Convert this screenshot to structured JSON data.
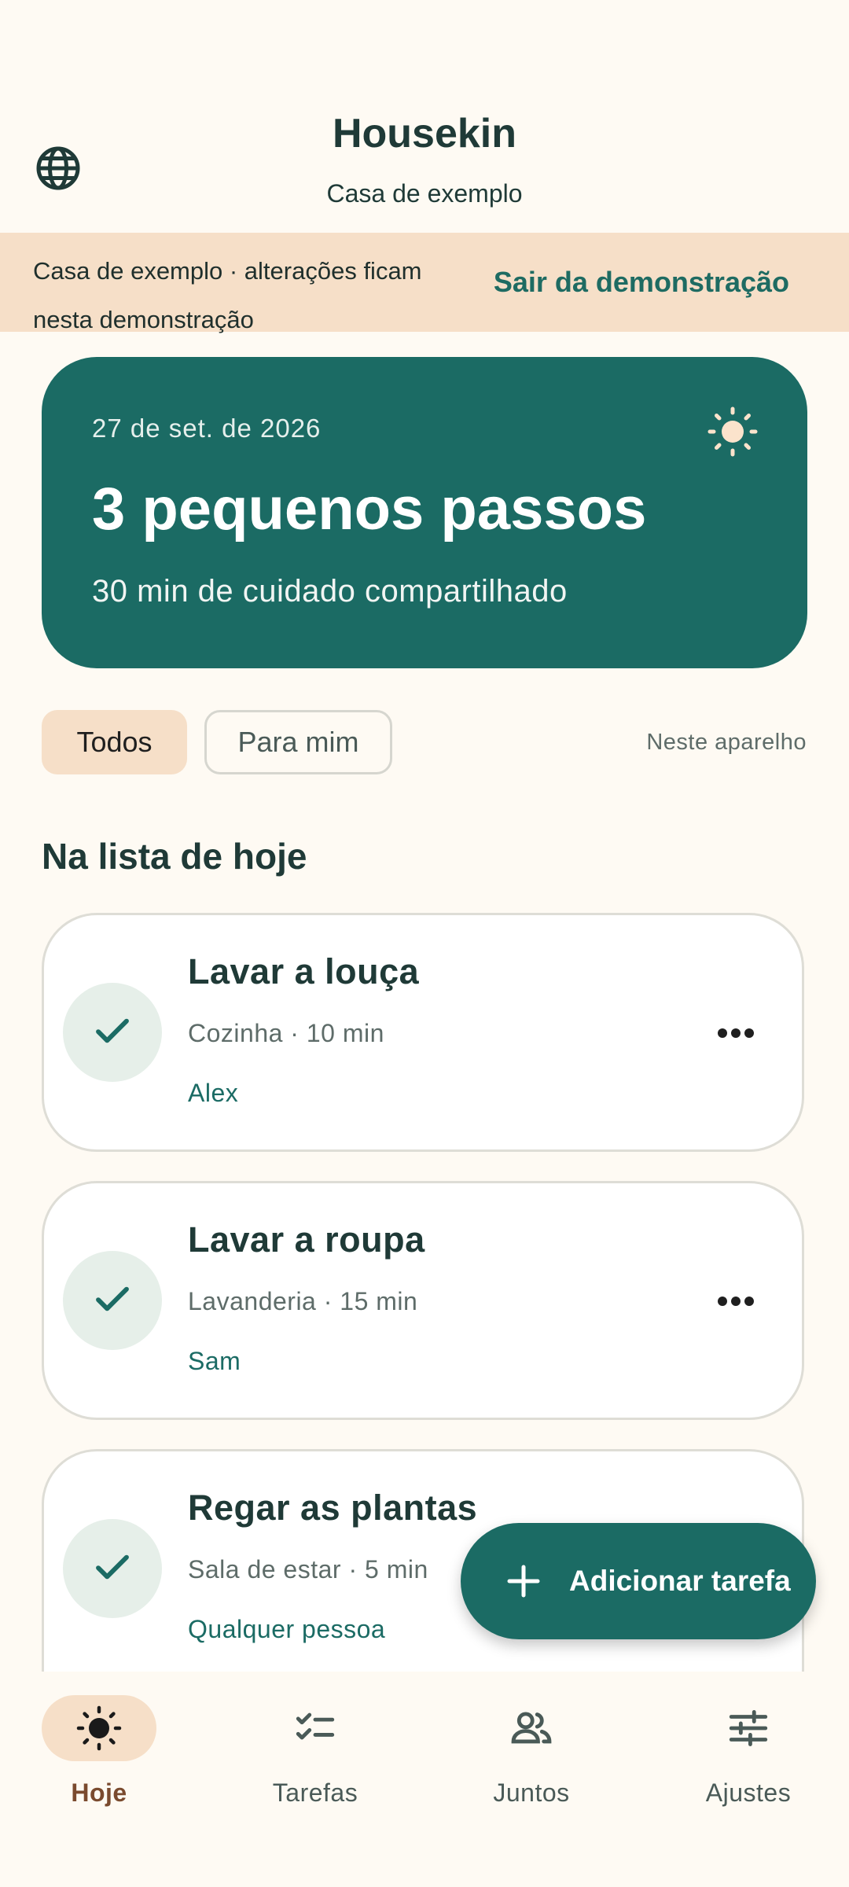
{
  "header": {
    "title": "Housekin",
    "subtitle": "Casa de exemplo",
    "language_icon": "globe-icon"
  },
  "banner": {
    "text": "Casa de exemplo · alterações ficam nesta demonstração",
    "action": "Sair da demonstração"
  },
  "hero": {
    "date": "27 de set. de 2026",
    "title": "3 pequenos passos",
    "subtitle": "30 min de cuidado compartilhado",
    "icon": "sun-icon"
  },
  "filters": {
    "all": "Todos",
    "mine": "Para mim",
    "selected": "Todos",
    "device_note": "Neste aparelho"
  },
  "section_title": "Na lista de hoje",
  "tasks": [
    {
      "title": "Lavar a louça",
      "meta": "Cozinha · 10 min",
      "assignee": "Alex"
    },
    {
      "title": "Lavar a roupa",
      "meta": "Lavanderia · 15 min",
      "assignee": "Sam"
    },
    {
      "title": "Regar as plantas",
      "meta": "Sala de estar · 5 min",
      "assignee": "Qualquer pessoa"
    }
  ],
  "fab": {
    "label": "Adicionar tarefa"
  },
  "nav": {
    "selected": "Hoje",
    "items": [
      {
        "label": "Hoje",
        "icon": "sun-icon"
      },
      {
        "label": "Tarefas",
        "icon": "checklist-icon"
      },
      {
        "label": "Juntos",
        "icon": "people-icon"
      },
      {
        "label": "Ajustes",
        "icon": "sliders-icon"
      }
    ]
  },
  "colors": {
    "background": "#FEFAF3",
    "primary": "#1B6B64",
    "banner": "#F6DFC8",
    "text": "#1F3A37"
  }
}
